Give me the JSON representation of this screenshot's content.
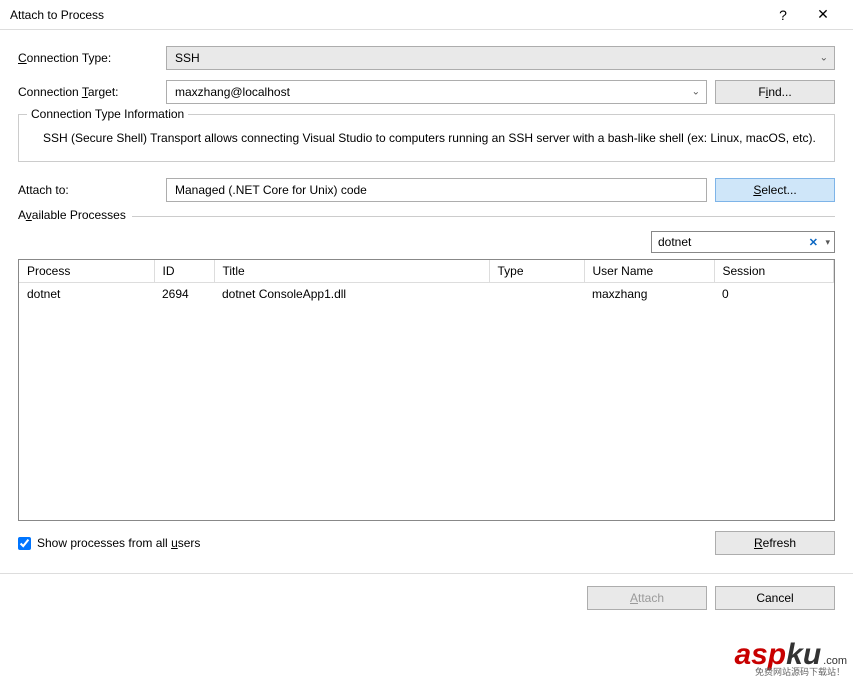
{
  "titlebar": {
    "title": "Attach to Process",
    "help_icon": "?",
    "close_icon": "✕"
  },
  "conn_type": {
    "label_prefix": "C",
    "label_rest": "onnection Type:",
    "value": "SSH"
  },
  "conn_target": {
    "label_prefix": "Connection ",
    "label_underline": "T",
    "label_suffix": "arget:",
    "value": "maxzhang@localhost",
    "find_prefix": "F",
    "find_underline": "i",
    "find_suffix": "nd..."
  },
  "info_box": {
    "legend": "Connection Type Information",
    "body": "SSH (Secure Shell) Transport allows connecting Visual Studio to computers running an SSH server with a bash-like shell (ex: Linux, macOS, etc)."
  },
  "attach_to": {
    "label": "Attach to:",
    "value": "Managed (.NET Core for Unix) code",
    "select_prefix": "S",
    "select_rest": "elect..."
  },
  "available": {
    "label_prefix": "A",
    "label_underline": "v",
    "label_suffix": "ailable Processes",
    "filter_value": "dotnet"
  },
  "table": {
    "headers": {
      "process": "Process",
      "id": "ID",
      "title": "Title",
      "type": "Type",
      "user": "User Name",
      "session": "Session"
    },
    "rows": [
      {
        "process": "dotnet",
        "id": "2694",
        "title": "dotnet ConsoleApp1.dll",
        "type": "",
        "user": "maxzhang",
        "session": "0"
      }
    ]
  },
  "show_all": {
    "label_prefix": "Show processes from all ",
    "label_underline": "u",
    "label_suffix": "sers",
    "checked": true
  },
  "refresh": {
    "underline": "R",
    "rest": "efresh"
  },
  "buttons": {
    "attach_underline": "A",
    "attach_rest": "ttach",
    "cancel": "Cancel"
  },
  "watermark": {
    "asp": "asp",
    "ku": "ku",
    "com": ".com",
    "sub": "免费网站源码下载站！"
  }
}
